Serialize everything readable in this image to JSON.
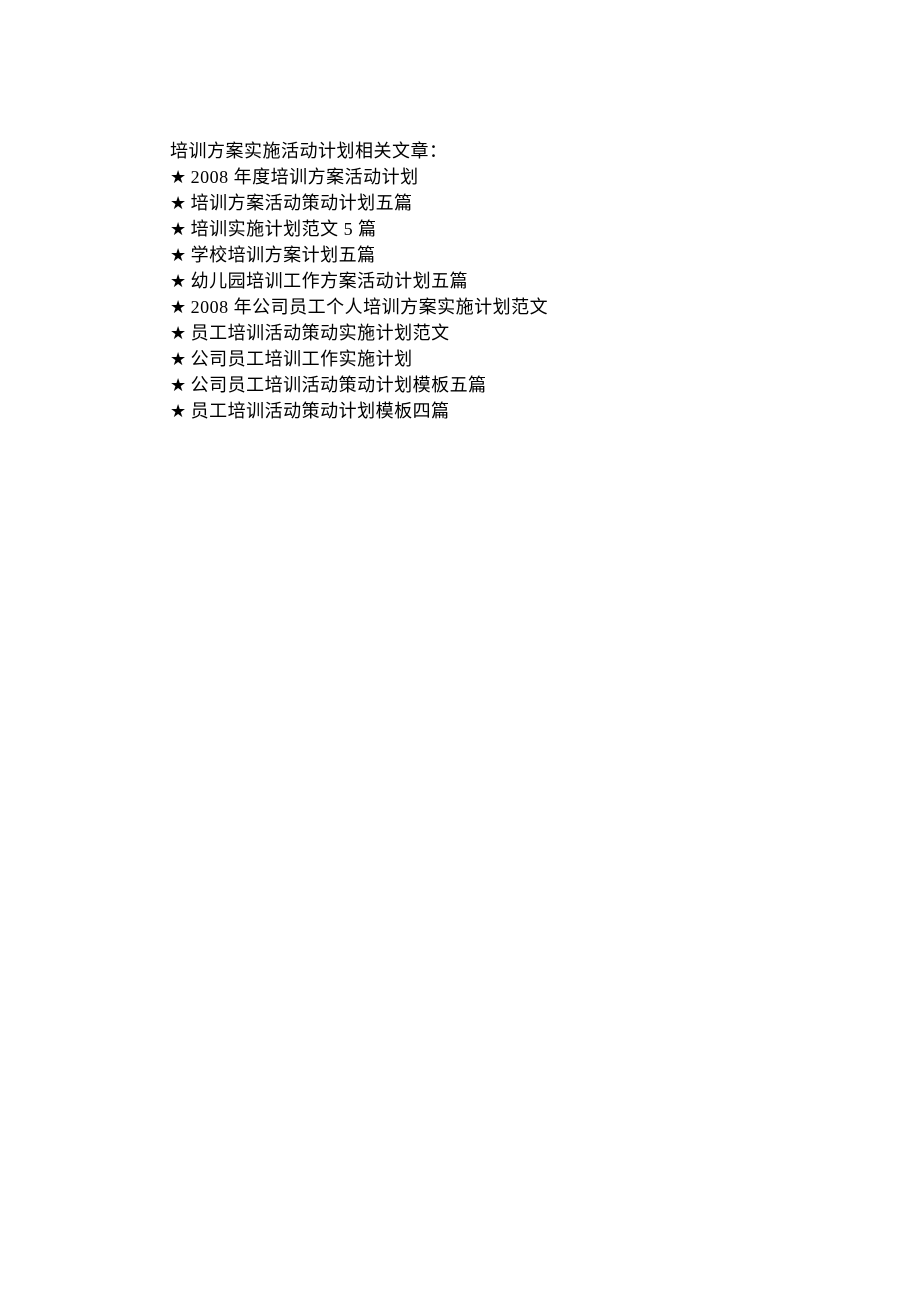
{
  "heading": "培训方案实施活动计划相关文章：",
  "star": "★",
  "articles": [
    {
      "text": "2008 年度培训方案活动计划"
    },
    {
      "text": " 培训方案活动策动计划五篇"
    },
    {
      "text": " 培训实施计划范文 5 篇"
    },
    {
      "text": " 学校培训方案计划五篇"
    },
    {
      "text": " 幼儿园培训工作方案活动计划五篇"
    },
    {
      "text": "2008 年公司员工个人培训方案实施计划范文"
    },
    {
      "text": " 员工培训活动策动实施计划范文"
    },
    {
      "text": " 公司员工培训工作实施计划"
    },
    {
      "text": " 公司员工培训活动策动计划模板五篇"
    },
    {
      "text": " 员工培训活动策动计划模板四篇"
    }
  ]
}
